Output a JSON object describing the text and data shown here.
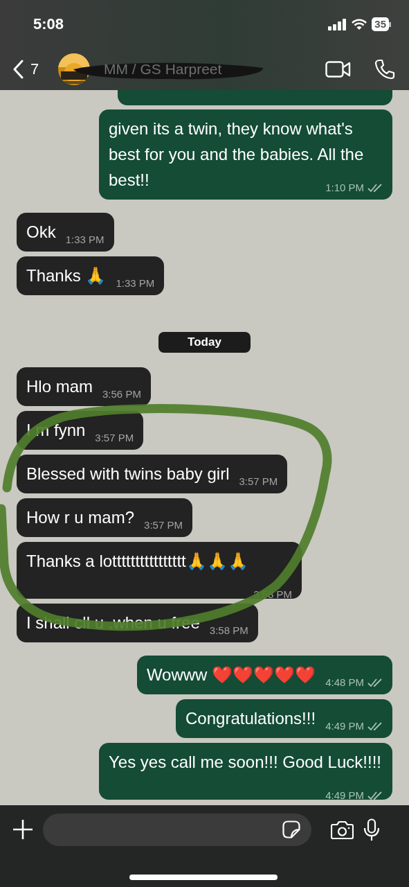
{
  "status_bar": {
    "time": "5:08",
    "battery": "35"
  },
  "header": {
    "back_count": "7",
    "contact_name": "MM / GS Harpreet",
    "name_scribbled": true
  },
  "messages": [
    {
      "kind": "cut-off"
    },
    {
      "kind": "outgoing",
      "text": "given its a twin, they know what's best for you and the babies. All the best!!",
      "time": "1:10 PM",
      "read": true
    },
    {
      "kind": "incoming",
      "text": "Okk",
      "time": "1:33 PM"
    },
    {
      "kind": "incoming",
      "text": "Thanks 🙏",
      "time": "1:33 PM"
    },
    {
      "kind": "date",
      "text": "Today"
    },
    {
      "kind": "incoming",
      "text": "Hlo mam",
      "time": "3:56 PM"
    },
    {
      "kind": "incoming",
      "text": "I m fynn",
      "time": "3:57 PM"
    },
    {
      "kind": "incoming",
      "text": "Blessed with twins baby girl",
      "time": "3:57 PM"
    },
    {
      "kind": "incoming",
      "text": "How r u mam?",
      "time": "3:57 PM"
    },
    {
      "kind": "incoming",
      "text": "Thanks a lotttttttttttttttt🙏🙏🙏",
      "time": "3:58 PM"
    },
    {
      "kind": "incoming",
      "text": "I shall cll u .when u free",
      "time": "3:58 PM"
    },
    {
      "kind": "outgoing",
      "text": "Wowww ❤️❤️❤️❤️❤️",
      "time": "4:48 PM",
      "read": true
    },
    {
      "kind": "outgoing",
      "text": "Congratulations!!!",
      "time": "4:49 PM",
      "read": true
    },
    {
      "kind": "outgoing",
      "text": "Yes yes call me soon!!! Good Luck!!!!",
      "time": "4:49 PM",
      "read": true
    }
  ],
  "annotation": {
    "kind": "marker-circle"
  }
}
